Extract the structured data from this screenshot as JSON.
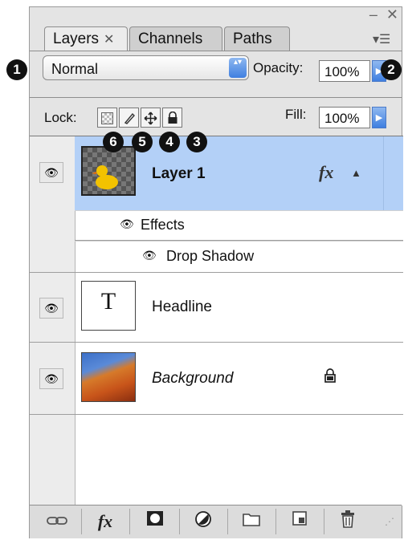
{
  "window": {
    "minimize_glyph": "–",
    "close_glyph": "✕",
    "panel_menu_glyph": "▾☰"
  },
  "tabs": [
    {
      "label": "Layers",
      "close_glyph": "✕"
    },
    {
      "label": "Channels"
    },
    {
      "label": "Paths"
    }
  ],
  "blend_mode": {
    "value": "Normal",
    "stepper_glyph": "▴▾"
  },
  "opacity": {
    "label": "Opacity:",
    "value": "100%",
    "arrow_glyph": "▶"
  },
  "lock": {
    "label": "Lock:",
    "icons": [
      "lock-transparent-pixels-icon",
      "lock-image-pixels-icon",
      "lock-position-icon",
      "lock-all-icon"
    ]
  },
  "fill": {
    "label": "Fill:",
    "value": "100%",
    "arrow_glyph": "▶"
  },
  "callouts": {
    "one": "1",
    "two": "2",
    "three": "3",
    "four": "4",
    "five": "5",
    "six": "6"
  },
  "layers": [
    {
      "name": "Layer 1",
      "effects_glyph": "fx",
      "expand_glyph": "▲",
      "selected": true
    },
    {
      "name": "Effects"
    },
    {
      "name": "Drop Shadow"
    },
    {
      "name": "Headline",
      "thumb_glyph": "T"
    },
    {
      "name": "Background",
      "lock_glyph": "🔒"
    }
  ],
  "eye_glyph": "👁",
  "footer": {
    "buttons": [
      "link-layers-icon",
      "fx-icon",
      "add-mask-icon",
      "adjustment-layer-icon",
      "new-group-icon",
      "new-layer-icon",
      "trash-icon"
    ],
    "fx_label": "fx"
  },
  "colors": {
    "selection": "#b3d0f7",
    "accent": "#3f7fe0"
  }
}
